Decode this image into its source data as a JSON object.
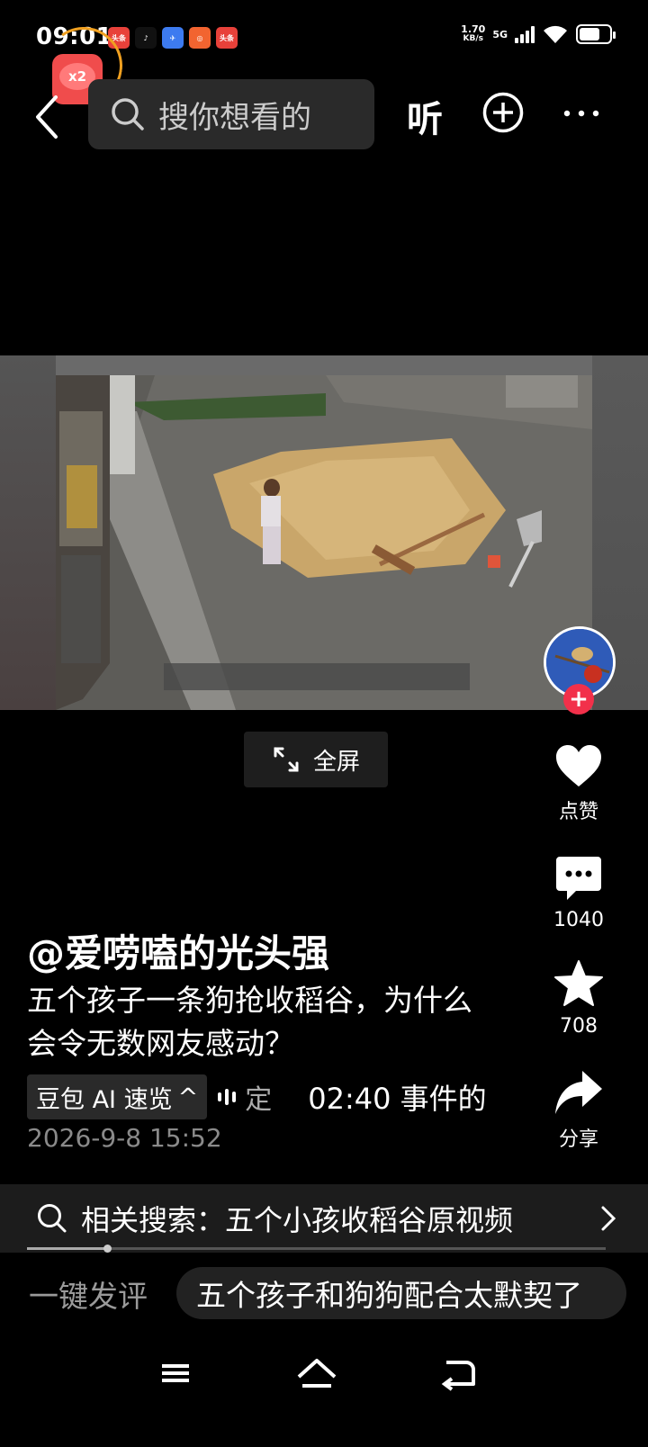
{
  "status_bar": {
    "time": "09:01",
    "speed_value": "1.70",
    "speed_unit": "KB/s",
    "network": "5G",
    "app_badges": [
      {
        "label": "头条",
        "color": "#e8413a"
      },
      {
        "label": "♪",
        "color": "#111111"
      },
      {
        "label": "✈",
        "color": "#3d7bf0"
      },
      {
        "label": "◎",
        "color": "#f26430"
      },
      {
        "label": "头条",
        "color": "#e8413a"
      }
    ],
    "battery_level": 0.7
  },
  "reward_badge": {
    "label": "x2"
  },
  "top_bar": {
    "search_placeholder": "搜你想看的",
    "listen_label": "听"
  },
  "video": {
    "fullscreen_label": "全屏"
  },
  "rail": {
    "like_label": "点赞",
    "comment_count": "1040",
    "favorite_count": "708",
    "share_label": "分享"
  },
  "post": {
    "author": "@爱唠嗑的光头强",
    "title": "五个孩子一条狗抢收稻谷，为什么会令无数网友感动？",
    "ai_button_label": "豆包 AI 速览",
    "ai_caret": "^",
    "ai_snippet": "定",
    "ai_timestamp": "02:40 事件的",
    "date": "2026-9-8 15:52"
  },
  "related_search": {
    "text": "相关搜索：五个小孩收稻谷原视频"
  },
  "progress": 0.14,
  "comment_bar": {
    "quick_label": "一键发评",
    "suggestion": "五个孩子和狗狗配合太默契了"
  },
  "nav": {
    "menu": "menu-icon",
    "home": "home-icon",
    "back": "back-icon"
  }
}
